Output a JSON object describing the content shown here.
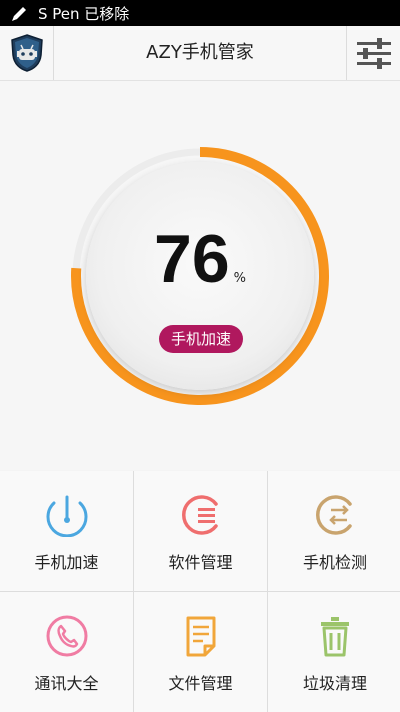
{
  "status_bar": {
    "text": "S Pen 已移除"
  },
  "header": {
    "title": "AZY手机管家"
  },
  "gauge": {
    "percent": 76,
    "percent_text": "76",
    "unit": "%",
    "boost_label": "手机加速",
    "arc_color": "#f7941d"
  },
  "tools": [
    {
      "label": "手机加速",
      "icon": "speedometer-icon",
      "color": "#4ba7e0"
    },
    {
      "label": "软件管理",
      "icon": "app-manage-icon",
      "color": "#ef6e6e"
    },
    {
      "label": "手机检测",
      "icon": "phone-check-icon",
      "color": "#c9a46e"
    },
    {
      "label": "通讯大全",
      "icon": "phone-call-icon",
      "color": "#f07ca3"
    },
    {
      "label": "文件管理",
      "icon": "file-icon",
      "color": "#f1a63a"
    },
    {
      "label": "垃圾清理",
      "icon": "trash-icon",
      "color": "#9bc46a"
    }
  ]
}
